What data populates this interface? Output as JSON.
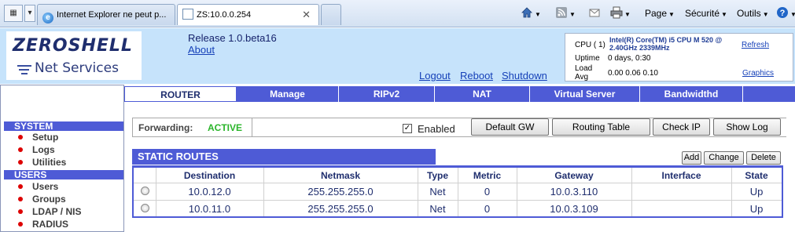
{
  "browser": {
    "tabs": [
      {
        "title": "Internet Explorer ne peut p..."
      },
      {
        "title": "ZS:10.0.0.254"
      }
    ],
    "tab_close_glyph": "✕",
    "toolbar": {
      "page_label": "Page",
      "security_label": "Sécurité",
      "tools_label": "Outils",
      "icons": [
        "home-icon",
        "rss-icon",
        "mail-icon",
        "print-icon",
        "help-icon"
      ]
    }
  },
  "header": {
    "logo_main": "ZEROSHELL",
    "logo_sub": "Net Services",
    "release": "Release 1.0.beta16",
    "about": "About",
    "logout": "Logout",
    "reboot": "Reboot",
    "shutdown": "Shutdown",
    "info": {
      "cpu_label": "CPU ( 1)",
      "cpu_model": "Intel(R) Core(TM) i5 CPU M 520 @ 2.40GHz 2339MHz",
      "refresh": "Refresh",
      "uptime_label": "Uptime",
      "uptime_value": "0 days, 0:30",
      "load_label": "Load Avg",
      "load_value": "0.00 0.06 0.10",
      "graphics": "Graphics"
    }
  },
  "sidebar": {
    "sections": [
      {
        "title": "SYSTEM",
        "items": [
          "Setup",
          "Logs",
          "Utilities"
        ]
      },
      {
        "title": "USERS",
        "items": [
          "Users",
          "Groups",
          "LDAP / NIS",
          "RADIUS"
        ]
      }
    ]
  },
  "main_tabs": [
    "ROUTER",
    "Manage",
    "RIPv2",
    "NAT",
    "Virtual Server",
    "Bandwidthd"
  ],
  "forwarding": {
    "label": "Forwarding:",
    "status": "ACTIVE",
    "enabled_label": "Enabled",
    "enabled_checked": true,
    "buttons": [
      "Default GW",
      "Routing Table",
      "Check IP",
      "Show Log"
    ]
  },
  "static_routes": {
    "title": "STATIC ROUTES",
    "actions": [
      "Add",
      "Change",
      "Delete"
    ],
    "columns": [
      "Destination",
      "Netmask",
      "Type",
      "Metric",
      "Gateway",
      "Interface",
      "State"
    ],
    "rows": [
      [
        "10.0.12.0",
        "255.255.255.0",
        "Net",
        "0",
        "10.0.3.110",
        "",
        "Up"
      ],
      [
        "10.0.11.0",
        "255.255.255.0",
        "Net",
        "0",
        "10.0.3.109",
        "",
        "Up"
      ]
    ]
  },
  "colors": {
    "accent": "#4e5bd6",
    "header_bg": "#c6e3fb",
    "active_status": "#2bb52b",
    "link": "#1540b8"
  }
}
